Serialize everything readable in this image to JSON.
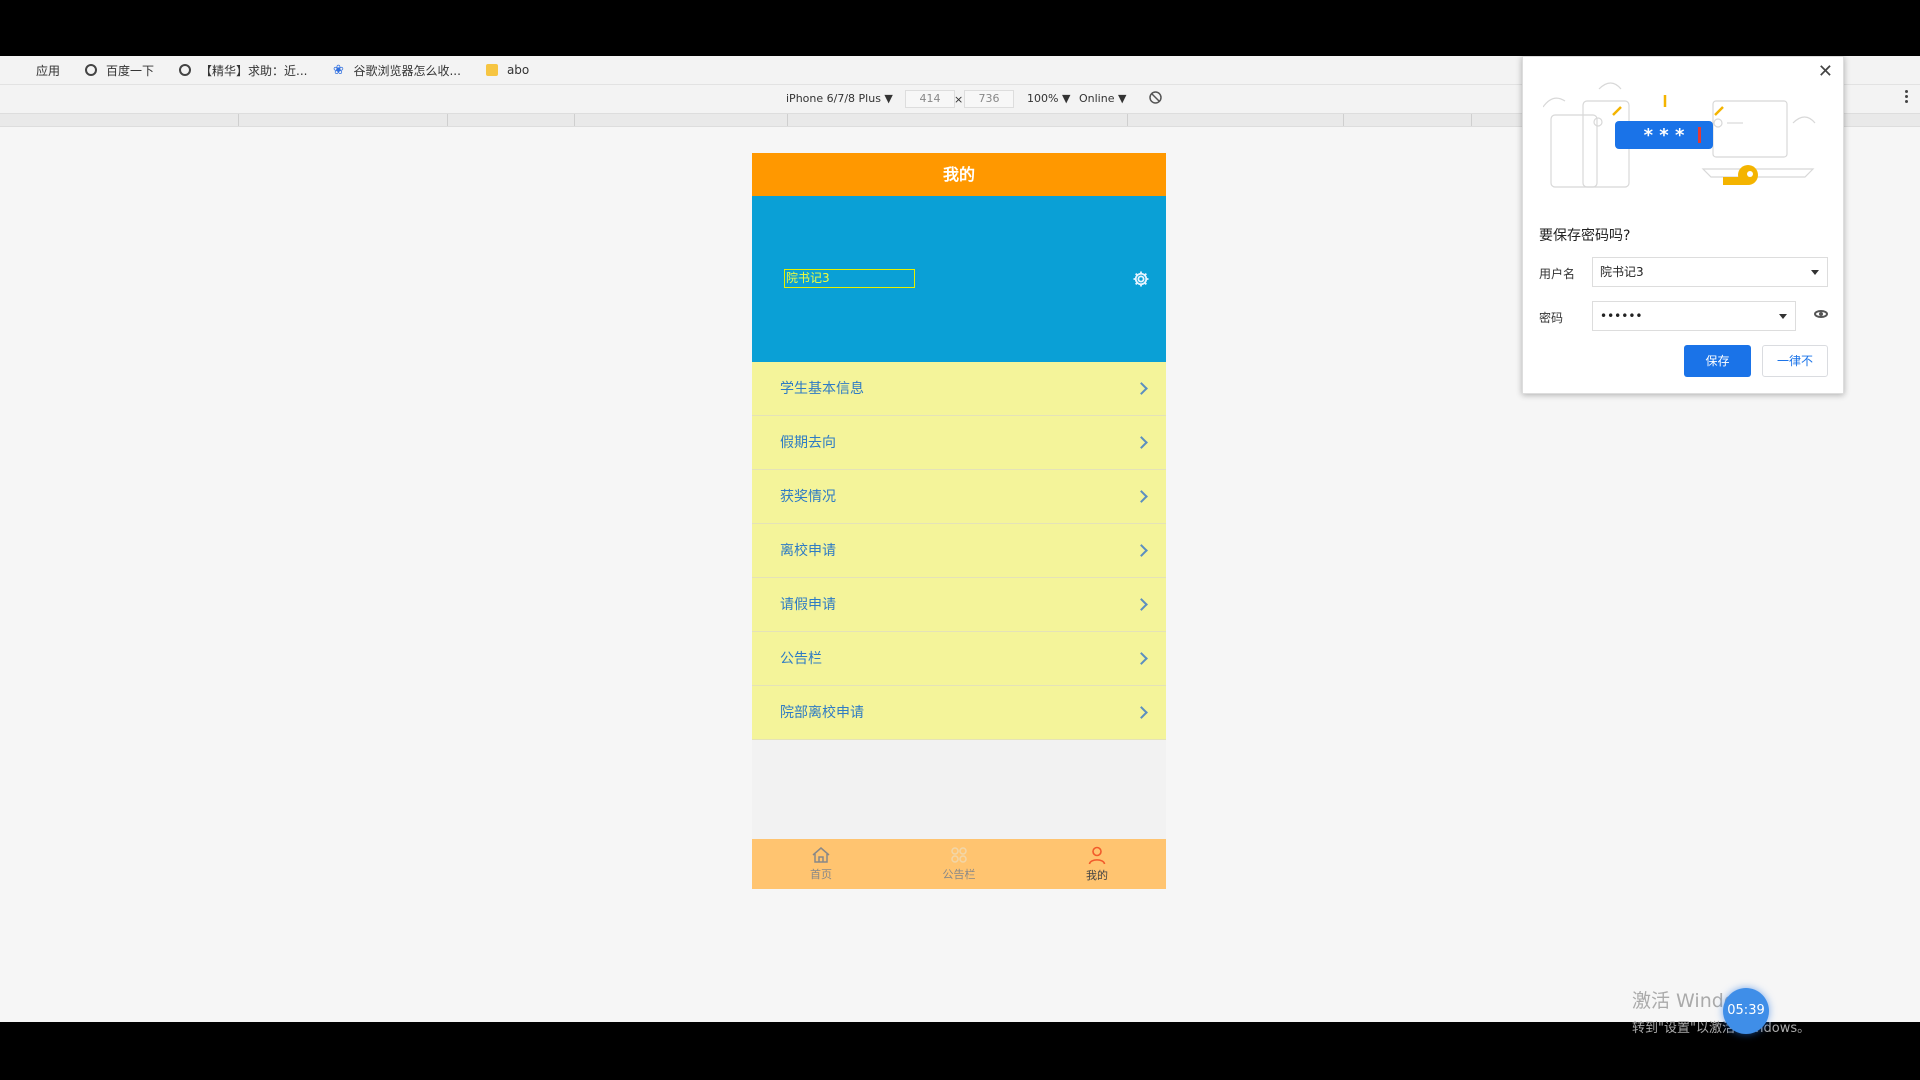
{
  "browser": {
    "bookmarks": [
      {
        "icon": "apps-grid-icon",
        "label": "应用"
      },
      {
        "icon": "globe-icon",
        "label": "百度一下"
      },
      {
        "icon": "globe-icon",
        "label": "【精华】求助：近..."
      },
      {
        "icon": "paw-icon",
        "label": "谷歌浏览器怎么收..."
      },
      {
        "icon": "folder-icon",
        "label": "abo"
      }
    ]
  },
  "devtools": {
    "device": "iPhone 6/7/8 Plus ▼",
    "width": "414",
    "times": "×",
    "height": "736",
    "zoom": "100% ▼",
    "network": "Online ▼"
  },
  "app": {
    "title": "我的",
    "username": "院书记3",
    "menu": [
      {
        "label": "学生基本信息"
      },
      {
        "label": "假期去向"
      },
      {
        "label": "获奖情况"
      },
      {
        "label": "离校申请"
      },
      {
        "label": "请假申请"
      },
      {
        "label": "公告栏"
      },
      {
        "label": "院部离校申请"
      }
    ],
    "tabs": [
      {
        "label": "首页",
        "icon": "home-icon"
      },
      {
        "label": "公告栏",
        "icon": "bulletin-icon"
      },
      {
        "label": "我的",
        "icon": "user-icon"
      }
    ],
    "colors": {
      "header": "#ff9800",
      "profile": "#0aa0d6",
      "menu": "#f4f49a",
      "tabbar": "#ffc470"
    }
  },
  "password_prompt": {
    "illustration_text": "* * *",
    "question": "要保存密码吗?",
    "username_label": "用户名",
    "username_value": "院书记3",
    "password_label": "密码",
    "password_value": "••••••",
    "save_label": "保存",
    "never_label": "一律不",
    "accent": "#1a73e8"
  },
  "watermark": {
    "line1": "激活 Windows",
    "line2": "转到\"设置\"以激活 Windows。",
    "clock": "05:39"
  }
}
